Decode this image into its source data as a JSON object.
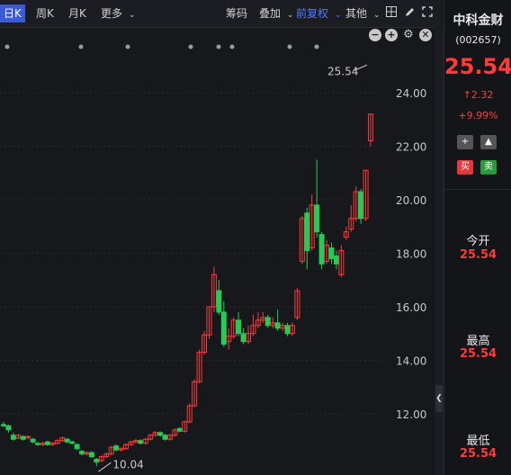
{
  "toolbar": {
    "period_tabs": [
      "日K",
      "周K",
      "月K",
      "更多"
    ],
    "right_items": [
      "筹码",
      "叠加",
      "前复权",
      "其他"
    ]
  },
  "stock": {
    "name": "中科金财",
    "code": "(002657)",
    "price": "25.54",
    "change": "2.32",
    "change_pct": "+9.99%",
    "buy_label": "买",
    "sell_label": "卖",
    "open_label": "今开",
    "open_value": "25.54",
    "high_label": "最高",
    "high_value": "25.54",
    "low_label": "最低",
    "low_value": "25.54"
  },
  "chart_data": {
    "type": "candlestick",
    "y_ticks": [
      "24.00",
      "22.00",
      "20.00",
      "18.00",
      "16.00",
      "14.00",
      "12.00"
    ],
    "ylim": [
      10.4,
      25.0
    ],
    "high_marker": "25.54",
    "low_marker": "10.04",
    "colors": {
      "up": "#ff3b3b",
      "down": "#22cc55"
    },
    "candles": [
      [
        11.6,
        11.55,
        11.7,
        11.5
      ],
      [
        11.55,
        11.4,
        11.6,
        11.3
      ],
      [
        11.2,
        11.05,
        11.3,
        11.0
      ],
      [
        11.1,
        11.2,
        11.25,
        11.05
      ],
      [
        11.15,
        11.05,
        11.2,
        11.0
      ],
      [
        11.1,
        11.15,
        11.2,
        11.05
      ],
      [
        11.05,
        10.95,
        11.1,
        10.9
      ],
      [
        10.9,
        10.85,
        10.95,
        10.8
      ],
      [
        10.85,
        10.9,
        10.95,
        10.8
      ],
      [
        10.95,
        10.85,
        11.0,
        10.8
      ],
      [
        10.85,
        10.9,
        10.95,
        10.8
      ],
      [
        10.9,
        11.0,
        11.05,
        10.85
      ],
      [
        11.0,
        11.1,
        11.15,
        10.95
      ],
      [
        11.05,
        10.95,
        11.1,
        10.9
      ],
      [
        10.95,
        10.9,
        11.0,
        10.85
      ],
      [
        10.85,
        10.7,
        10.9,
        10.65
      ],
      [
        10.6,
        10.5,
        10.65,
        10.45
      ],
      [
        10.5,
        10.55,
        10.6,
        10.45
      ],
      [
        10.55,
        10.4,
        10.6,
        10.35
      ],
      [
        10.3,
        10.2,
        10.35,
        10.04
      ],
      [
        10.25,
        10.4,
        10.45,
        10.2
      ],
      [
        10.4,
        10.5,
        10.55,
        10.35
      ],
      [
        10.5,
        10.75,
        10.8,
        10.45
      ],
      [
        10.8,
        10.65,
        10.85,
        10.6
      ],
      [
        10.65,
        10.7,
        10.75,
        10.6
      ],
      [
        10.7,
        10.85,
        10.9,
        10.65
      ],
      [
        10.85,
        10.95,
        11.0,
        10.8
      ],
      [
        10.95,
        11.0,
        11.05,
        10.9
      ],
      [
        11.0,
        10.9,
        11.05,
        10.85
      ],
      [
        10.9,
        11.05,
        11.1,
        10.85
      ],
      [
        11.05,
        11.2,
        11.25,
        11.0
      ],
      [
        11.2,
        11.3,
        11.35,
        11.15
      ],
      [
        11.3,
        11.2,
        11.35,
        11.15
      ],
      [
        11.2,
        11.05,
        11.25,
        11.0
      ],
      [
        11.05,
        11.2,
        11.25,
        11.0
      ],
      [
        11.2,
        11.4,
        11.45,
        11.15
      ],
      [
        11.45,
        11.35,
        11.5,
        11.3
      ],
      [
        11.35,
        11.7,
        11.75,
        11.3
      ],
      [
        11.7,
        12.3,
        12.4,
        11.65
      ],
      [
        12.3,
        13.2,
        13.3,
        12.25
      ],
      [
        13.2,
        14.3,
        14.4,
        13.15
      ],
      [
        14.3,
        14.95,
        15.1,
        14.2
      ],
      [
        14.95,
        16.0,
        16.0,
        14.8
      ],
      [
        16.0,
        17.2,
        17.5,
        15.8
      ],
      [
        16.6,
        15.8,
        17.0,
        15.7
      ],
      [
        15.8,
        14.6,
        16.2,
        14.5
      ],
      [
        14.7,
        14.9,
        15.2,
        14.4
      ],
      [
        14.9,
        15.5,
        15.6,
        14.8
      ],
      [
        15.5,
        15.0,
        15.8,
        14.9
      ],
      [
        15.0,
        14.7,
        15.2,
        14.6
      ],
      [
        14.7,
        15.0,
        15.3,
        14.6
      ],
      [
        15.0,
        15.3,
        15.7,
        14.9
      ],
      [
        15.3,
        15.5,
        15.8,
        15.2
      ],
      [
        15.5,
        15.6,
        15.8,
        15.4
      ],
      [
        15.6,
        15.3,
        15.7,
        15.2
      ],
      [
        15.3,
        15.4,
        15.6,
        15.2
      ],
      [
        15.4,
        15.2,
        15.9,
        15.1
      ],
      [
        15.2,
        15.3,
        15.4,
        15.1
      ],
      [
        15.3,
        15.0,
        15.4,
        14.9
      ],
      [
        15.0,
        15.3,
        15.4,
        14.9
      ],
      [
        15.6,
        16.6,
        16.7,
        15.5
      ],
      [
        17.7,
        19.3,
        19.4,
        17.6
      ],
      [
        19.5,
        18.1,
        19.7,
        17.4
      ],
      [
        18.2,
        19.8,
        20.2,
        18.1
      ],
      [
        19.8,
        18.8,
        21.5,
        18.6
      ],
      [
        18.7,
        17.6,
        18.8,
        17.4
      ],
      [
        17.7,
        18.3,
        18.5,
        17.6
      ],
      [
        18.2,
        17.8,
        18.4,
        17.6
      ],
      [
        17.9,
        17.6,
        18.1,
        17.4
      ],
      [
        17.2,
        18.1,
        18.3,
        17.1
      ],
      [
        18.6,
        18.8,
        19.0,
        18.5
      ],
      [
        18.9,
        19.3,
        19.8,
        18.8
      ],
      [
        19.3,
        20.3,
        20.5,
        19.2
      ],
      [
        20.3,
        19.3,
        20.4,
        19.1
      ],
      [
        19.3,
        21.1,
        21.1,
        19.2
      ],
      [
        22.2,
        23.2,
        23.2,
        22.0
      ]
    ]
  }
}
